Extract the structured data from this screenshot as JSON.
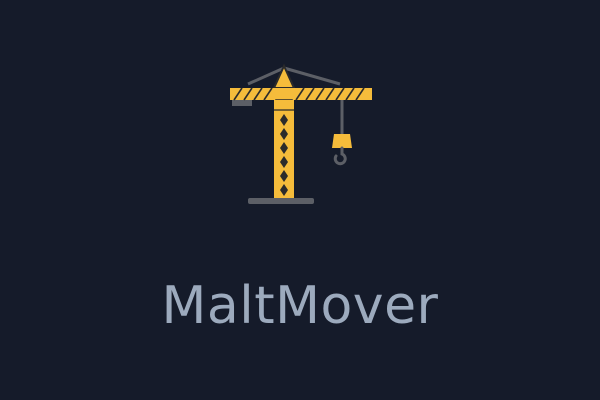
{
  "app": {
    "name": "MaltMover",
    "logo_icon": "construction-crane-icon"
  },
  "colors": {
    "background": "#151b2a",
    "title_text": "#9caabd",
    "crane_yellow": "#f5bc3b",
    "crane_outline": "#2b2b2b",
    "crane_gray": "#5c5f66",
    "cab_blue": "#5b8fd6"
  }
}
